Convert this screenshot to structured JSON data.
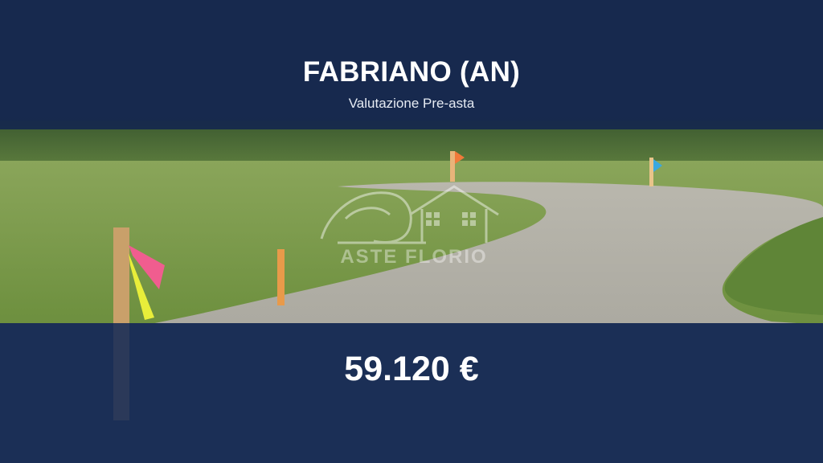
{
  "header": {
    "title": "FABRIANO (AN)",
    "subtitle": "Valutazione Pre-asta"
  },
  "price": {
    "value": "59.120 €"
  },
  "watermark": {
    "logo_text": "ASTE FLORIO"
  },
  "colors": {
    "banner_navy": "#16284e",
    "text_white": "#ffffff"
  }
}
